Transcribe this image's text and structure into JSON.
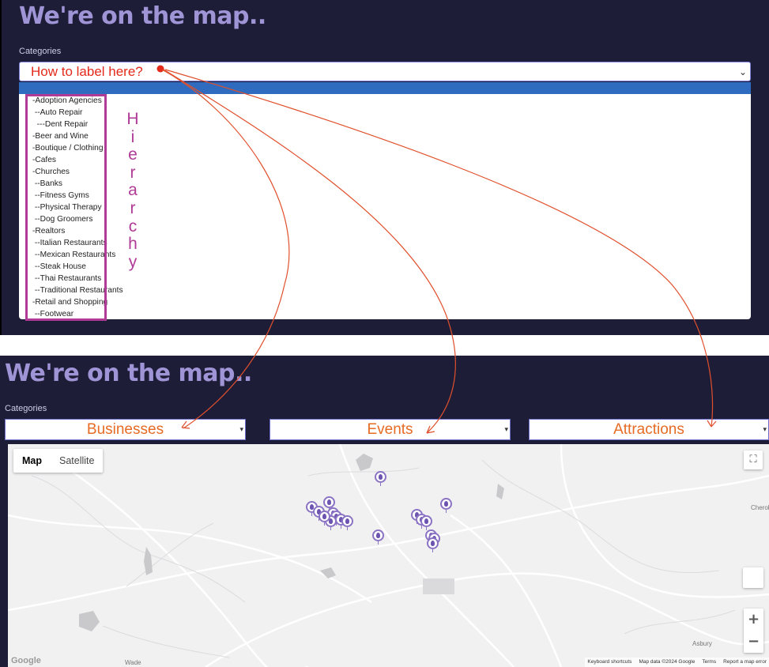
{
  "top_panel": {
    "heading": "We're on the map..",
    "categories_label": "Categories",
    "select_annotation": "How to label here?",
    "dropdown_options": [
      "-Adoption Agencies",
      " --Auto Repair",
      "  ---Dent Repair",
      "-Beer and Wine",
      "-Boutique / Clothing",
      "-Cafes",
      "-Churches",
      " --Banks",
      " --Fitness Gyms",
      " --Physical Therapy",
      " --Dog Groomers",
      "-Realtors",
      " --Italian Restaurants",
      " --Mexican Restaurants",
      " --Steak House",
      " --Thai Restaurants",
      " --Traditional Restaurants",
      "-Retail and Shopping",
      " --Footwear"
    ],
    "hierarchy_letters": [
      "H",
      "i",
      "e",
      "r",
      "a",
      "r",
      "c",
      "h",
      "y"
    ]
  },
  "bottom_panel": {
    "heading": "We're on the map..",
    "categories_label": "Categories",
    "selects": [
      "Businesses",
      "Events",
      "Attractions"
    ]
  },
  "map": {
    "toggle": [
      "Map",
      "Satellite"
    ],
    "towns": [
      "Cherok",
      "Asbury",
      "Wade"
    ],
    "footer": [
      "Keyboard shortcuts",
      "Map data ©2024 Google",
      "Terms",
      "Report a map error"
    ],
    "logo": "Google",
    "zoom_in": "+",
    "zoom_out": "−"
  },
  "colors": {
    "panel_bg": "#1e1d38",
    "heading": "#9f95d6",
    "annotation_red": "#e32a1b",
    "annotation_orange": "#e66b24",
    "hierarchy_magenta": "#b03b97",
    "pin_purple": "#8b73c4"
  }
}
